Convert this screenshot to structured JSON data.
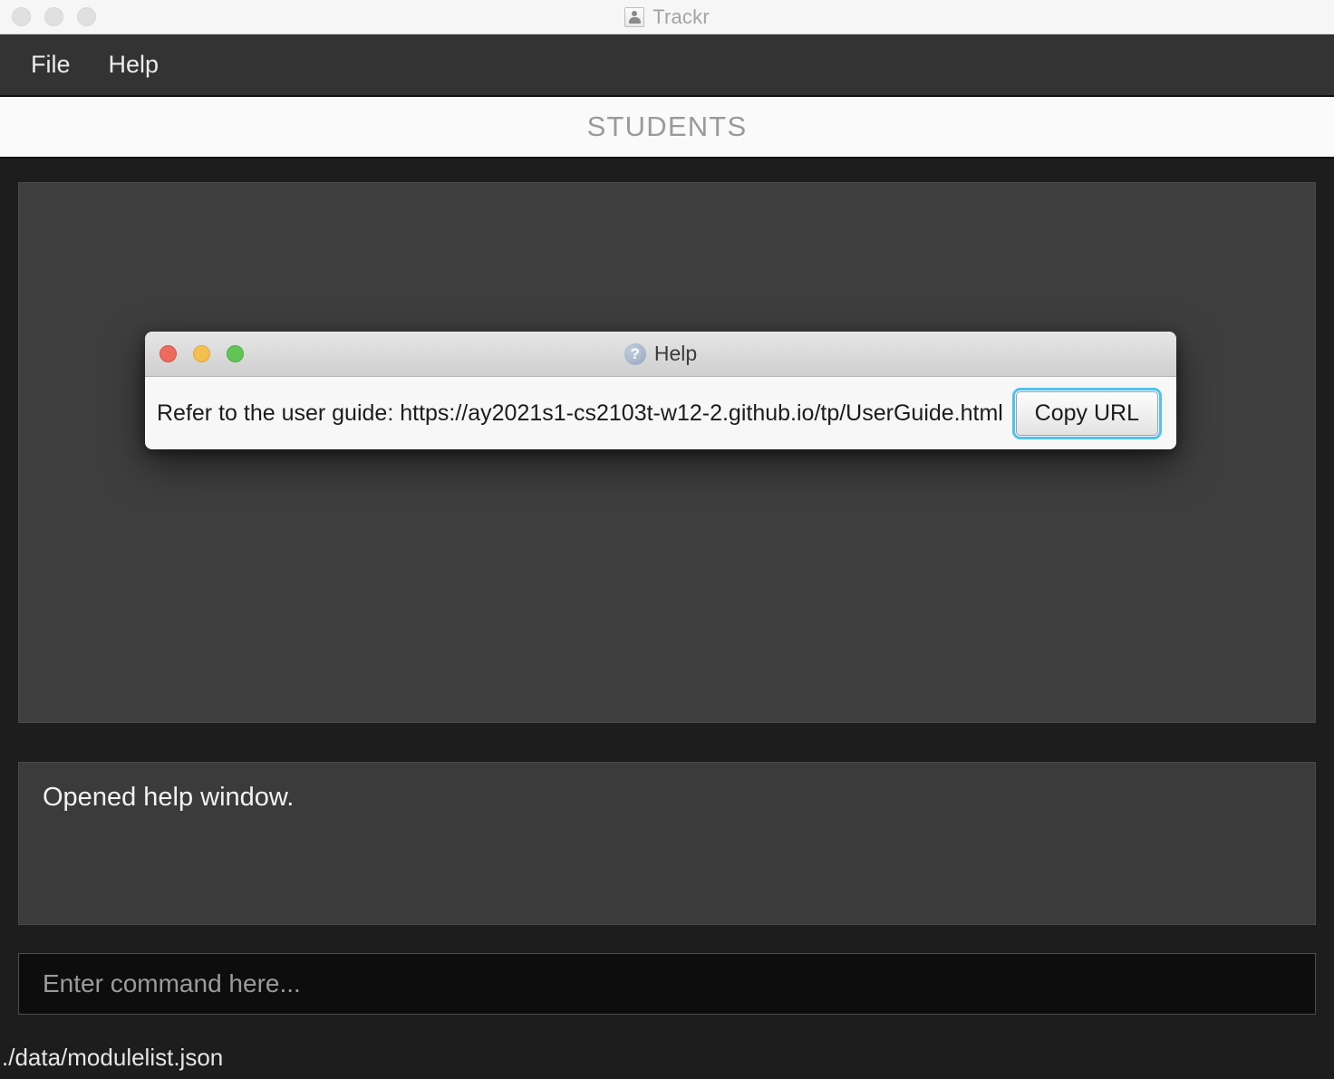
{
  "window": {
    "title": "Trackr",
    "icon": "contact-card-icon",
    "traffic_lights": [
      "close",
      "minimize",
      "zoom"
    ]
  },
  "menubar": {
    "items": [
      {
        "label": "File",
        "name": "menu-file"
      },
      {
        "label": "Help",
        "name": "menu-help"
      }
    ]
  },
  "header": {
    "title": "STUDENTS"
  },
  "main": {
    "list_panel_empty": "",
    "result_display": "Opened help window.",
    "command_input": {
      "value": "",
      "placeholder": "Enter command here..."
    },
    "status_bar": "./data/modulelist.json"
  },
  "help_dialog": {
    "title": "Help",
    "title_icon": "question-mark-icon",
    "message": "Refer to the user guide: https://ay2021s1-cs2103t-w12-2.github.io/tp/UserGuide.html",
    "copy_button": "Copy URL",
    "traffic_lights": [
      "close",
      "minimize",
      "zoom"
    ]
  },
  "colors": {
    "window_chrome": "#f6f6f6",
    "menubar_bg": "#333333",
    "app_bg": "#1d1d1d",
    "panel_bg": "#3f3f3f",
    "command_bg": "#0d0d0d",
    "title_text": "#9a9a9a",
    "focus_ring": "#4cc3f0",
    "light_red": "#ec6a5e",
    "light_yellow": "#f5bf4f",
    "light_green": "#61c454"
  }
}
